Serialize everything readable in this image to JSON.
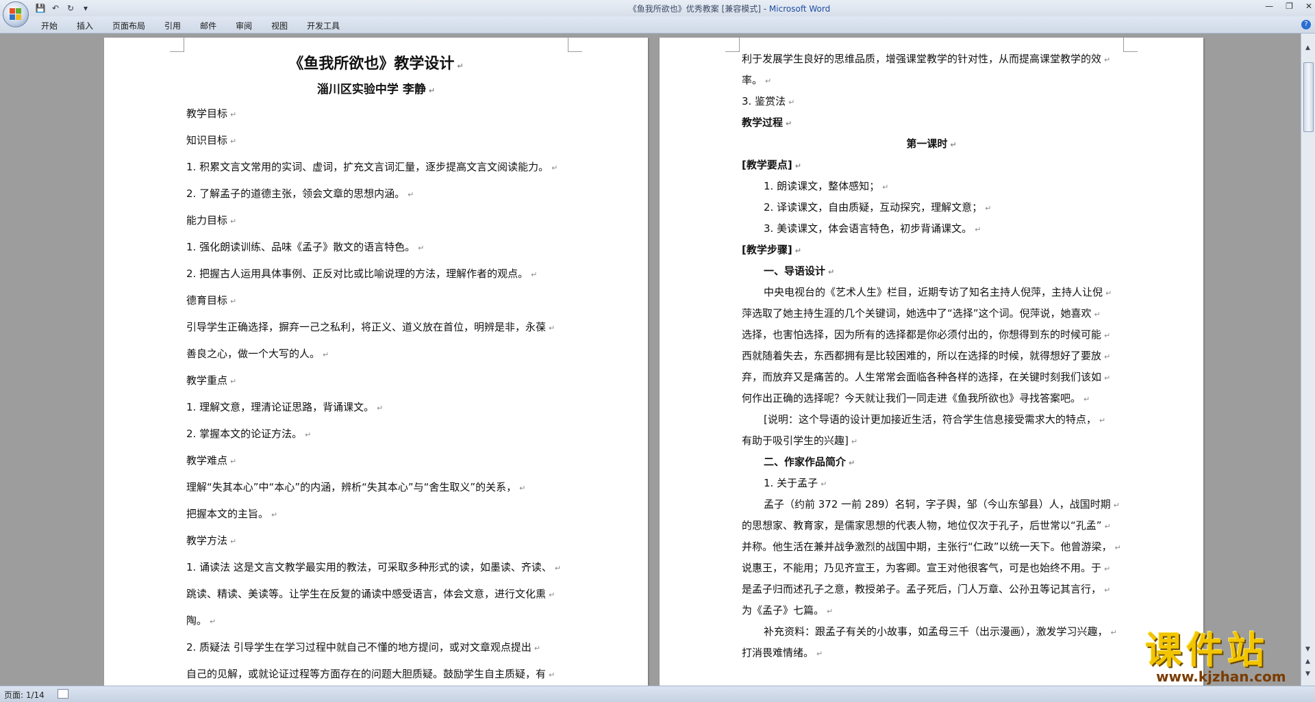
{
  "titlebar": {
    "doc_title": "《鱼我所欲也》优秀教案 [兼容模式] - ",
    "app_name": "Microsoft Word"
  },
  "qat": {
    "save": "💾",
    "undo": "↶",
    "redo": "↻",
    "customize": "▾"
  },
  "tabs": [
    "开始",
    "插入",
    "页面布局",
    "引用",
    "邮件",
    "审阅",
    "视图",
    "开发工具"
  ],
  "page1": {
    "lines": [
      {
        "text": "《鱼我所欲也》教学设计",
        "bold": true,
        "size": 22,
        "align": "center"
      },
      {
        "text": "淄川区实验中学    李静",
        "bold": true,
        "size": 17,
        "align": "center"
      },
      {
        "text": "教学目标"
      },
      {
        "text": "知识目标"
      },
      {
        "text": "1. 积累文言文常用的实词、虚词，扩充文言词汇量，逐步提高文言文阅读能力。"
      },
      {
        "text": "2. 了解孟子的道德主张，领会文章的思想内涵。"
      },
      {
        "text": "能力目标"
      },
      {
        "text": "1. 强化朗读训练、品味《孟子》散文的语言特色。"
      },
      {
        "text": "2. 把握古人运用具体事例、正反对比或比喻说理的方法，理解作者的观点。"
      },
      {
        "text": "德育目标"
      },
      {
        "text": "引导学生正确选择，摒弃一己之私利，将正义、道义放在首位，明辨是非，永葆"
      },
      {
        "text": "善良之心，做一个大写的人。"
      },
      {
        "text": "教学重点"
      },
      {
        "text": "1. 理解文意，理清论证思路，背诵课文。"
      },
      {
        "text": "2. 掌握本文的论证方法。"
      },
      {
        "text": "教学难点"
      },
      {
        "text": "理解“失其本心”中“本心”的内涵，辨析“失其本心”与“舍生取义”的关系，"
      },
      {
        "text": "把握本文的主旨。"
      },
      {
        "text": "教学方法"
      },
      {
        "text": "1. 诵读法  这是文言文教学最实用的教法，可采取多种形式的读，如墨读、齐读、"
      },
      {
        "text": "跳读、精读、美读等。让学生在反复的诵读中感受语言，体会文意，进行文化熏"
      },
      {
        "text": "陶。"
      },
      {
        "text": "2. 质疑法   引导学生在学习过程中就自己不懂的地方提问，或对文章观点提出"
      },
      {
        "text": "自己的见解，或就论证过程等方面存在的问题大胆质疑。鼓励学生自主质疑，有"
      }
    ]
  },
  "page2": {
    "lines": [
      {
        "text": "利于发展学生良好的思维品质，增强课堂教学的针对性，从而提高课堂教学的效"
      },
      {
        "text": "率。"
      },
      {
        "text": "3. 鉴赏法"
      },
      {
        "text": "教学过程",
        "bold": true
      },
      {
        "text": "第一课时",
        "bold": true,
        "align": "center"
      },
      {
        "text": "[教学要点]",
        "bold": true
      },
      {
        "text": "1. 朗读课文，整体感知；",
        "indent": 1
      },
      {
        "text": "2. 译读课文，自由质疑，互动探究，理解文意；",
        "indent": 1
      },
      {
        "text": "3. 美读课文，体会语言特色，初步背诵课文。",
        "indent": 1
      },
      {
        "text": "[教学步骤]",
        "bold": true
      },
      {
        "text": "一、导语设计",
        "bold": true,
        "indent": 1
      },
      {
        "text": "中央电视台的《艺术人生》栏目，近期专访了知名主持人倪萍，主持人让倪",
        "indent": 1
      },
      {
        "text": "萍选取了她主持生涯的几个关键词，她选中了“选择”这个词。倪萍说，她喜欢"
      },
      {
        "text": "选择，也害怕选择，因为所有的选择都是你必须付出的，你想得到东的时候可能"
      },
      {
        "text": "西就随着失去，东西都拥有是比较困难的，所以在选择的时候，就得想好了要放"
      },
      {
        "text": "弃，而放弃又是痛苦的。人生常常会面临各种各样的选择，在关键时刻我们该如"
      },
      {
        "text": "何作出正确的选择呢？今天就让我们一同走进《鱼我所欲也》寻找答案吧。"
      },
      {
        "text": "[说明：这个导语的设计更加接近生活，符合学生信息接受需求大的特点，",
        "indent": 1
      },
      {
        "text": "有助于吸引学生的兴趣]"
      },
      {
        "text": "二、作家作品简介",
        "bold": true,
        "indent": 1
      },
      {
        "text": "1. 关于孟子",
        "indent": 1
      },
      {
        "text": "孟子（约前 372 一前 289）名轲，字子舆，邹（今山东邹县）人，战国时期",
        "indent": 1
      },
      {
        "text": "的思想家、教育家，是儒家思想的代表人物，地位仅次于孔子，后世常以“孔孟”"
      },
      {
        "text": "并称。他生活在兼并战争激烈的战国中期，主张行“仁政”以统一天下。他曾游梁，"
      },
      {
        "text": "说惠王，不能用；乃见齐宣王，为客卿。宣王对他很客气，可是也始终不用。于"
      },
      {
        "text": "是孟子归而述孔子之意，教授弟子。孟子死后，门人万章、公孙丑等记其言行，"
      },
      {
        "text": "为《孟子》七篇。"
      },
      {
        "text": "补充资料：跟孟子有关的小故事，如孟母三千（出示漫画），激发学习兴趣，",
        "indent": 1
      },
      {
        "text": "打消畏难情绪。"
      }
    ]
  },
  "status": {
    "page_count": "页面: 1/14"
  },
  "watermark": {
    "main": "课件站",
    "url": "www.kjzhan.com"
  }
}
